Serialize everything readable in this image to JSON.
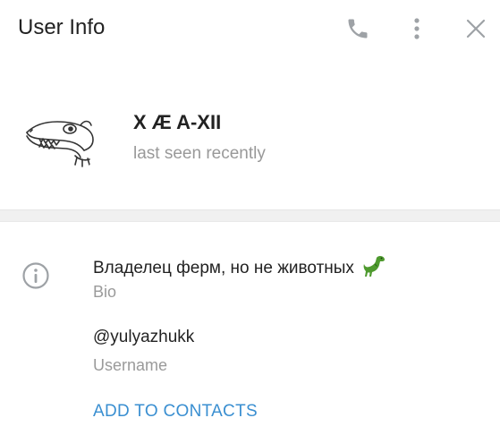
{
  "header": {
    "title": "User Info",
    "icons": [
      "phone-icon",
      "more-vertical-icon",
      "close-icon"
    ]
  },
  "profile": {
    "name": "X Æ A-XII",
    "status": "last seen recently",
    "avatar_icon": "crocodile-avatar"
  },
  "info": {
    "icon": "info-icon",
    "bio_value": "Владелец ферм, но не животных",
    "bio_emoji": "dinosaur-icon",
    "bio_label": "Bio",
    "username_value": "@yulyazhukk",
    "username_label": "Username",
    "add_contacts": "ADD TO CONTACTS"
  },
  "colors": {
    "link": "#3a8fd1",
    "muted": "#999999",
    "text": "#222222",
    "icon": "#9ea2a6"
  }
}
